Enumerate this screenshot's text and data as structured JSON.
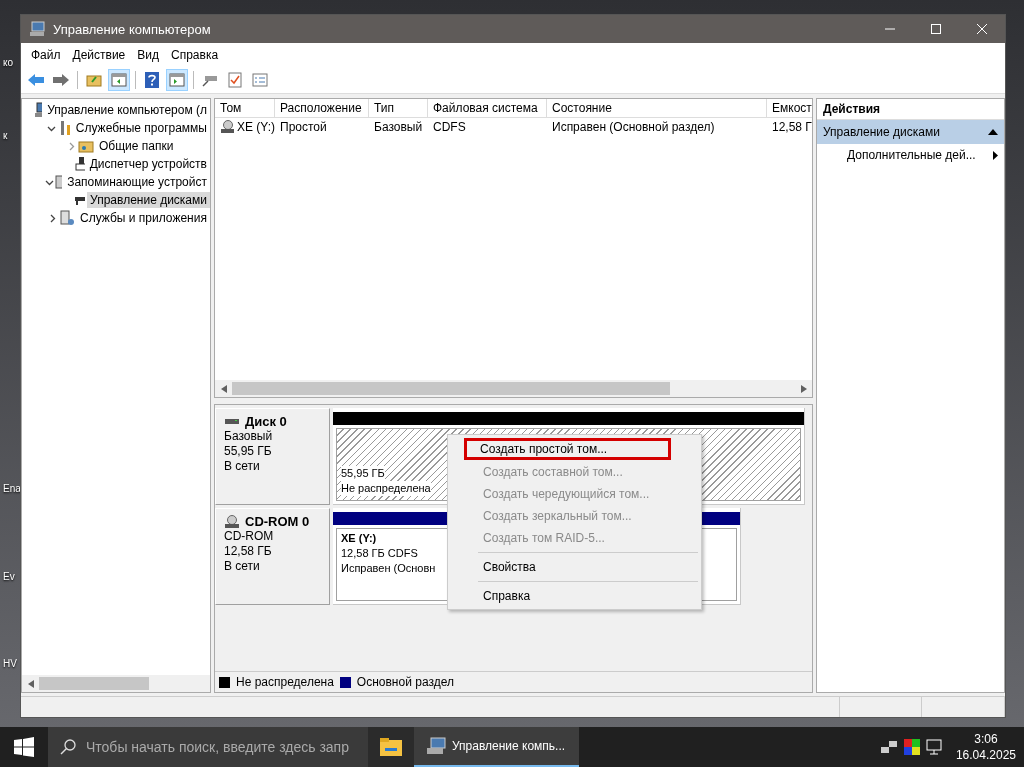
{
  "desktop_labels": [
    "ко",
    "к",
    "Ena",
    "Ev",
    "HV"
  ],
  "window": {
    "title": "Управление компьютером"
  },
  "menu": [
    "Файл",
    "Действие",
    "Вид",
    "Справка"
  ],
  "toolbar": [
    {
      "kind": "back",
      "selected": false
    },
    {
      "kind": "forward",
      "selected": false
    },
    {
      "kind": "sep"
    },
    {
      "kind": "folder-up",
      "selected": false
    },
    {
      "kind": "console-tree",
      "selected": true
    },
    {
      "kind": "sep"
    },
    {
      "kind": "help",
      "selected": false
    },
    {
      "kind": "action-pane",
      "selected": true
    },
    {
      "kind": "sep"
    },
    {
      "kind": "connect",
      "selected": false
    },
    {
      "kind": "check-doc",
      "selected": false
    },
    {
      "kind": "checklist",
      "selected": false
    }
  ],
  "tree": [
    {
      "label": "Управление компьютером (л",
      "selected": false,
      "children": [
        {
          "label": "Служебные программы",
          "expanded": true,
          "selected": false,
          "children": [
            {
              "label": "Общие папки",
              "expanded": false,
              "selected": false
            },
            {
              "label": "Диспетчер устройств",
              "selected": false
            }
          ]
        },
        {
          "label": "Запоминающие устройст",
          "expanded": true,
          "selected": false,
          "children": [
            {
              "label": "Управление дисками",
              "selected": true
            }
          ]
        },
        {
          "label": "Службы и приложения",
          "expanded": false,
          "selected": false
        }
      ]
    }
  ],
  "table": {
    "columns": [
      "Том",
      "Расположение",
      "Тип",
      "Файловая система",
      "Состояние",
      "Емкост"
    ],
    "rows": [
      [
        "XE (Y:)",
        "Простой",
        "Базовый",
        "CDFS",
        "Исправен (Основной раздел)",
        "12,58 Г"
      ]
    ]
  },
  "disks": [
    {
      "name": "Диск 0",
      "kind": "hdd",
      "type": "Базовый",
      "size": "55,95 ГБ",
      "status": "В сети",
      "partitions": [
        {
          "kind": "unallocated",
          "color": "#000000",
          "lines": [
            "55,95 ГБ",
            "Не распределена"
          ]
        }
      ]
    },
    {
      "name": "CD-ROM 0",
      "kind": "cdrom",
      "type": "CD-ROM",
      "size": "12,58 ГБ",
      "status": "В сети",
      "partitions": [
        {
          "kind": "primary",
          "color": "#000080",
          "title": "XE  (Y:)",
          "lines": [
            "12,58 ГБ CDFS",
            "Исправен (Основн"
          ]
        }
      ]
    }
  ],
  "legend": [
    {
      "label": "Не распределена",
      "color": "#000000"
    },
    {
      "label": "Основной раздел",
      "color": "#000080"
    }
  ],
  "context_menu": [
    {
      "kind": "item",
      "label": "Создать простой том...",
      "disabled": false,
      "highlighted": true
    },
    {
      "kind": "item",
      "label": "Создать составной том...",
      "disabled": true,
      "highlighted": false
    },
    {
      "kind": "item",
      "label": "Создать чередующийся том...",
      "disabled": true,
      "highlighted": false
    },
    {
      "kind": "item",
      "label": "Создать зеркальный том...",
      "disabled": true,
      "highlighted": false
    },
    {
      "kind": "item",
      "label": "Создать том RAID-5...",
      "disabled": true,
      "highlighted": false
    },
    {
      "kind": "separator"
    },
    {
      "kind": "item",
      "label": "Свойства",
      "disabled": false,
      "highlighted": false
    },
    {
      "kind": "separator"
    },
    {
      "kind": "item",
      "label": "Справка",
      "disabled": false,
      "highlighted": false
    }
  ],
  "actions": {
    "title": "Действия",
    "section": "Управление дисками",
    "items": [
      "Дополнительные дей..."
    ]
  },
  "taskbar": {
    "search_placeholder": "Чтобы начать поиск, введите здесь запр",
    "app": "Управление компь...",
    "time": "3:06",
    "date": "16.04.2025"
  }
}
